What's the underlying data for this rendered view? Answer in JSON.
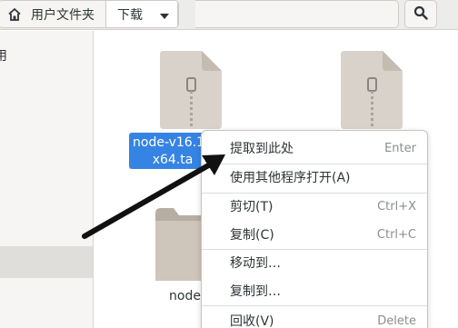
{
  "header": {
    "home_label": "用户文件夹",
    "current_folder": "下载",
    "icons": {
      "home": "home-icon",
      "dropdown": "chevron-down-icon",
      "search": "search-icon"
    }
  },
  "sidebar": {
    "partial_item_label": "用"
  },
  "content": {
    "selected_file_label": "node-v16.15\nx64.ta",
    "folder_label": "node",
    "icons": {
      "archive": "archive-file-icon",
      "folder": "folder-icon"
    }
  },
  "context_menu": {
    "items": [
      {
        "label": "提取到此处",
        "accel": "Enter"
      },
      {
        "label": "使用其他程序打开(A)",
        "accel": ""
      },
      {
        "label": "剪切(T)",
        "accel": "Ctrl+X"
      },
      {
        "label": "复制(C)",
        "accel": "Ctrl+C"
      },
      {
        "label": "移动到…",
        "accel": ""
      },
      {
        "label": "复制到…",
        "accel": ""
      },
      {
        "label": "回收(V)",
        "accel": "Delete"
      }
    ]
  },
  "annotation": {
    "icon": "arrow-annotation",
    "color": "#111111"
  },
  "colors": {
    "selection": "#3584e4",
    "header_bg": "#ececeb",
    "sidebar_bg": "#f6f5f4"
  }
}
